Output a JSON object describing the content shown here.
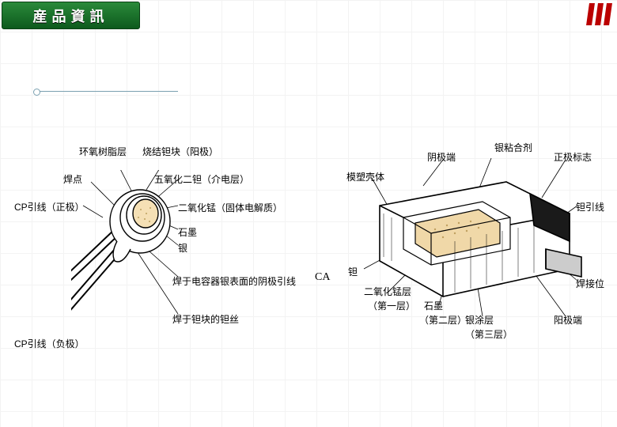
{
  "header": {
    "title": "産品資訊"
  },
  "center_text": "CA",
  "left_diagram": {
    "labels": {
      "epoxy": "环氧树脂层",
      "sinter_anode": "烧结钽块（阳极）",
      "weld_point": "焊点",
      "ta2o5": "五氧化二钽（介电层）",
      "cp_pos": "CP引线（正极）",
      "mn02": "二氧化锰（固体电解质）",
      "graphite": "石墨",
      "silver": "银",
      "neg_lead": "焊于电容器银表面的阴极引线",
      "ta_wire": "焊于钽块的钽丝",
      "cp_neg": "CP引线（负极）"
    }
  },
  "right_diagram": {
    "labels": {
      "silver_adhesive": "银粘合剂",
      "cathode_end": "阴极端",
      "pos_mark": "正极标志",
      "mold_body": "模塑壳体",
      "ta_lead": "钽引线",
      "tantalum": "钽",
      "weld_pos": "焊接位",
      "mn02_layer": "二氧化锰层",
      "layer1": "（第一层）",
      "graphite": "石墨",
      "layer2": "（第二层）",
      "silver_coat": "银涂层",
      "anode_end": "阳极端",
      "layer3": "（第三层）"
    }
  }
}
